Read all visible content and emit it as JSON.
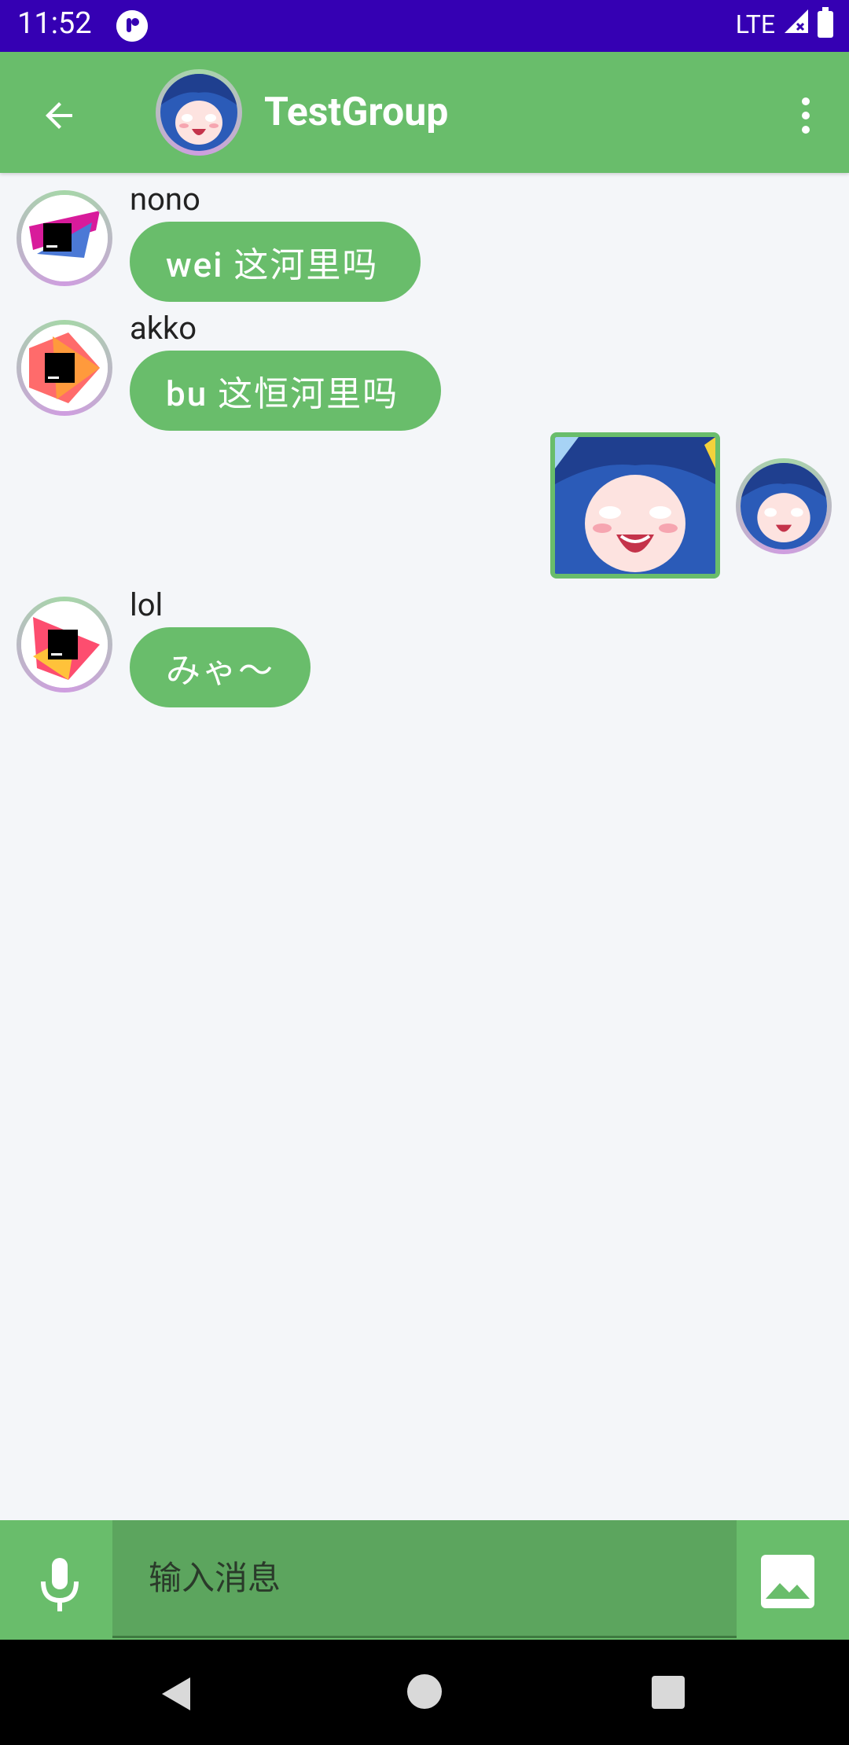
{
  "status_bar": {
    "time": "11:52",
    "network": "LTE"
  },
  "header": {
    "title": "TestGroup"
  },
  "messages": [
    {
      "sender": "nono",
      "text": "wei 这河里吗"
    },
    {
      "sender": "akko",
      "text": "bu 这恒河里吗"
    },
    {
      "sender": "lol",
      "text": "みゃ〜"
    }
  ],
  "input": {
    "placeholder": "输入消息"
  },
  "colors": {
    "accent": "#69bd6b",
    "status_bar": "#3500b3",
    "background": "#f4f6f9"
  },
  "icons": [
    "back-arrow-icon",
    "more-vert-icon",
    "mic-icon",
    "image-icon",
    "nav-back-icon",
    "nav-home-icon",
    "nav-recents-icon"
  ]
}
